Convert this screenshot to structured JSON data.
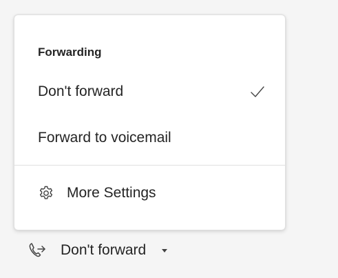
{
  "menu": {
    "header": "Forwarding",
    "items": [
      {
        "label": "Don't forward",
        "selected": true
      },
      {
        "label": "Forward to voicemail",
        "selected": false
      }
    ],
    "settings": {
      "label": "More Settings",
      "icon": "gear-icon"
    }
  },
  "control": {
    "label": "Don't forward",
    "icon": "call-forward-icon",
    "dropdown_icon": "caret-down-icon"
  },
  "colors": {
    "background": "#f5f5f5",
    "menu_background": "#ffffff",
    "text": "#242424",
    "divider": "#e0e0e0"
  }
}
